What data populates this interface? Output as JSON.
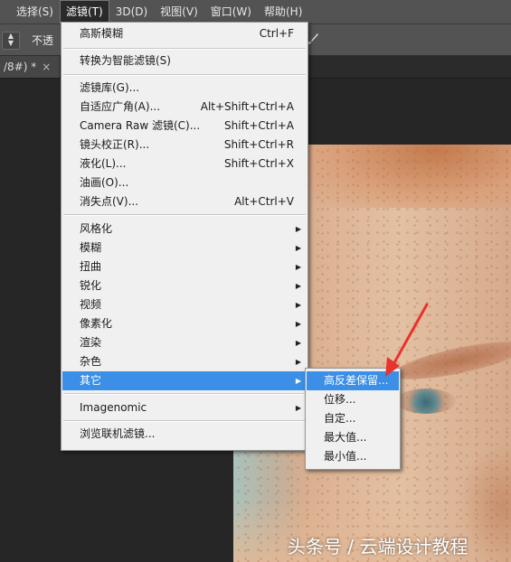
{
  "menubar": {
    "items": [
      {
        "label": "选择(S)"
      },
      {
        "label": "滤镜(T)",
        "active": true
      },
      {
        "label": "3D(D)"
      },
      {
        "label": "视图(V)"
      },
      {
        "label": "窗口(W)"
      },
      {
        "label": "帮助(H)"
      }
    ]
  },
  "options_bar": {
    "opacity_label": "不透"
  },
  "document_tab": {
    "title": "/8#) *",
    "close": "×"
  },
  "filter_menu": {
    "items": [
      {
        "label": "高斯模糊",
        "shortcut": "Ctrl+F"
      },
      {
        "label": "转换为智能滤镜(S)"
      },
      {
        "label": "滤镜库(G)..."
      },
      {
        "label": "自适应广角(A)...",
        "shortcut": "Alt+Shift+Ctrl+A"
      },
      {
        "label": "Camera Raw 滤镜(C)...",
        "shortcut": "Shift+Ctrl+A"
      },
      {
        "label": "镜头校正(R)...",
        "shortcut": "Shift+Ctrl+R"
      },
      {
        "label": "液化(L)...",
        "shortcut": "Shift+Ctrl+X"
      },
      {
        "label": "油画(O)..."
      },
      {
        "label": "消失点(V)...",
        "shortcut": "Alt+Ctrl+V"
      },
      {
        "label": "风格化",
        "submenu": true
      },
      {
        "label": "模糊",
        "submenu": true
      },
      {
        "label": "扭曲",
        "submenu": true
      },
      {
        "label": "锐化",
        "submenu": true
      },
      {
        "label": "视频",
        "submenu": true
      },
      {
        "label": "像素化",
        "submenu": true
      },
      {
        "label": "渲染",
        "submenu": true
      },
      {
        "label": "杂色",
        "submenu": true
      },
      {
        "label": "其它",
        "submenu": true,
        "highlighted": true
      },
      {
        "label": "Imagenomic",
        "submenu": true
      },
      {
        "label": "浏览联机滤镜..."
      }
    ]
  },
  "other_submenu": {
    "items": [
      {
        "label": "高反差保留...",
        "highlighted": true
      },
      {
        "label": "位移..."
      },
      {
        "label": "自定..."
      },
      {
        "label": "最大值..."
      },
      {
        "label": "最小值..."
      }
    ]
  },
  "watermark": "头条号 / 云端设计教程",
  "colors": {
    "menu_highlight": "#3b8fe6",
    "menubar_bg": "#535353",
    "workspace_bg": "#262626",
    "annotation_arrow": "#e8332f"
  }
}
